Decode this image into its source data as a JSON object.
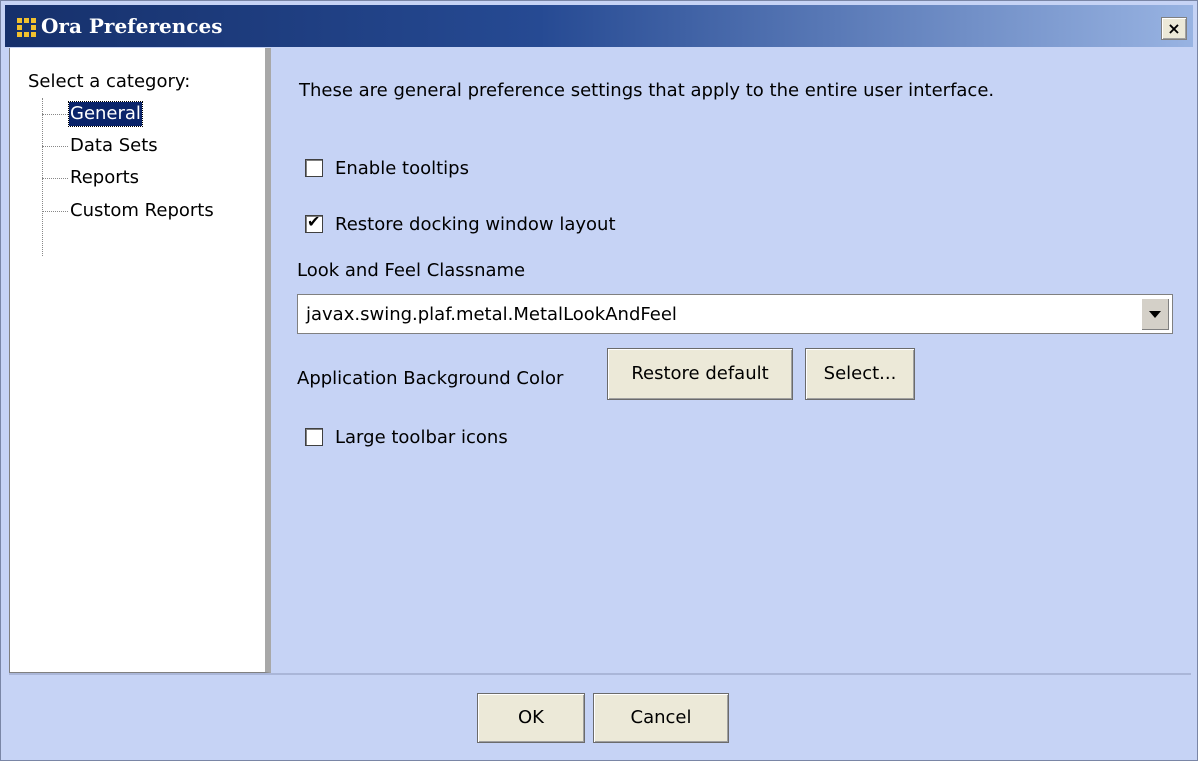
{
  "window": {
    "title": "Ora Preferences",
    "close_label": "×"
  },
  "sidebar": {
    "heading": "Select a category:",
    "items": [
      {
        "label": "General",
        "selected": true
      },
      {
        "label": "Data Sets",
        "selected": false
      },
      {
        "label": "Reports",
        "selected": false
      },
      {
        "label": "Custom Reports",
        "selected": false
      }
    ]
  },
  "general": {
    "intro": "These are general preference settings that apply to the entire user interface.",
    "enable_tooltips": {
      "label": "Enable tooltips",
      "checked": false
    },
    "restore_docking": {
      "label": "Restore docking window layout",
      "checked": true
    },
    "look_feel_label": "Look and Feel Classname",
    "look_feel_value": "javax.swing.plaf.metal.MetalLookAndFeel",
    "bg_color_label": "Application Background Color",
    "restore_default_label": "Restore default",
    "select_label": "Select...",
    "large_icons": {
      "label": "Large toolbar icons",
      "checked": false
    }
  },
  "footer": {
    "ok_label": "OK",
    "cancel_label": "Cancel"
  },
  "colors": {
    "panel_background": "#c6d3f5",
    "title_gradient_start": "#16306b",
    "selection": "#0a246a"
  }
}
